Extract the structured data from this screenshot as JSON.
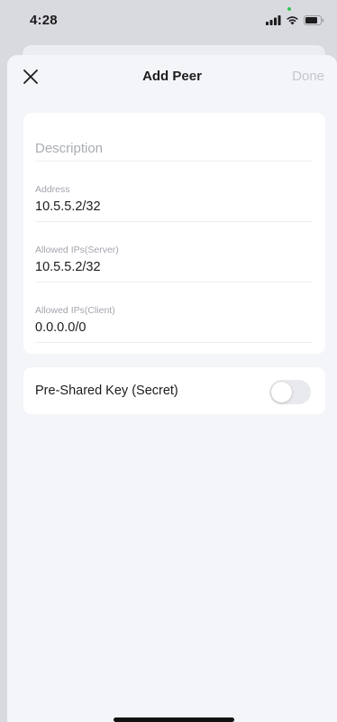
{
  "status_bar": {
    "time": "4:28"
  },
  "header": {
    "title": "Add Peer",
    "done_label": "Done"
  },
  "form": {
    "description": {
      "placeholder": "Description",
      "value": ""
    },
    "address": {
      "label": "Address",
      "value": "10.5.5.2/32"
    },
    "allowed_ips_server": {
      "label": "Allowed IPs(Server)",
      "value": "10.5.5.2/32"
    },
    "allowed_ips_client": {
      "label": "Allowed IPs(Client)",
      "value": "0.0.0.0/0"
    }
  },
  "pre_shared_key": {
    "label": "Pre-Shared Key (Secret)",
    "enabled": false
  },
  "colors": {
    "sheet_background": "#f4f5f8",
    "card_background": "#ffffff",
    "done_disabled": "#c4c6cc",
    "label_gray": "#a3a6ad",
    "toggle_off": "#e9eaed"
  },
  "icons": {
    "close": "close-icon",
    "signal": "cellular-signal-icon",
    "wifi": "wifi-icon",
    "battery": "battery-icon"
  }
}
